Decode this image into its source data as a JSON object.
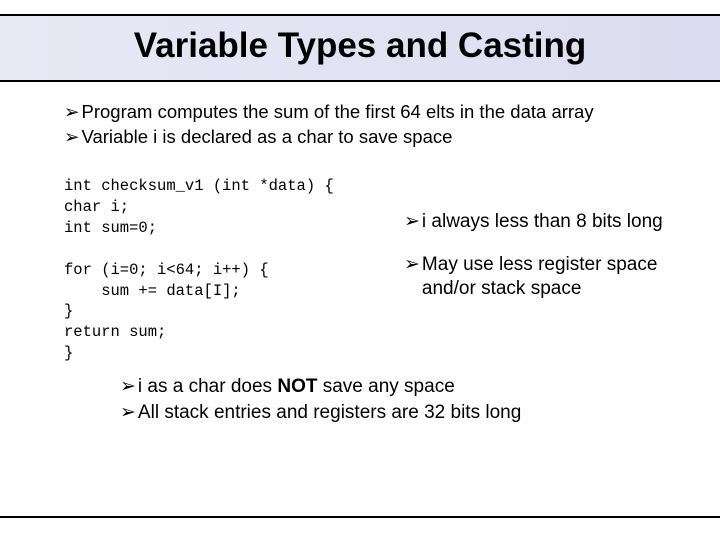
{
  "title": "Variable Types and Casting",
  "intro": {
    "b1": "Program computes the sum of the first 64 elts in the data array",
    "b2": "Variable i is declared as a char to save space"
  },
  "code": "int checksum_v1 (int *data) {\nchar i;\nint sum=0;\n\nfor (i=0; i<64; i++) {\n    sum += data[I];\n}\nreturn sum;\n}",
  "right": {
    "r1": "i always less than 8 bits long",
    "r2": "May use less register space and/or stack space"
  },
  "bottom": {
    "c1_pre": "i as a char does ",
    "c1_strong": "NOT",
    "c1_post": " save any space",
    "c2": "All stack entries and registers are 32 bits long"
  }
}
